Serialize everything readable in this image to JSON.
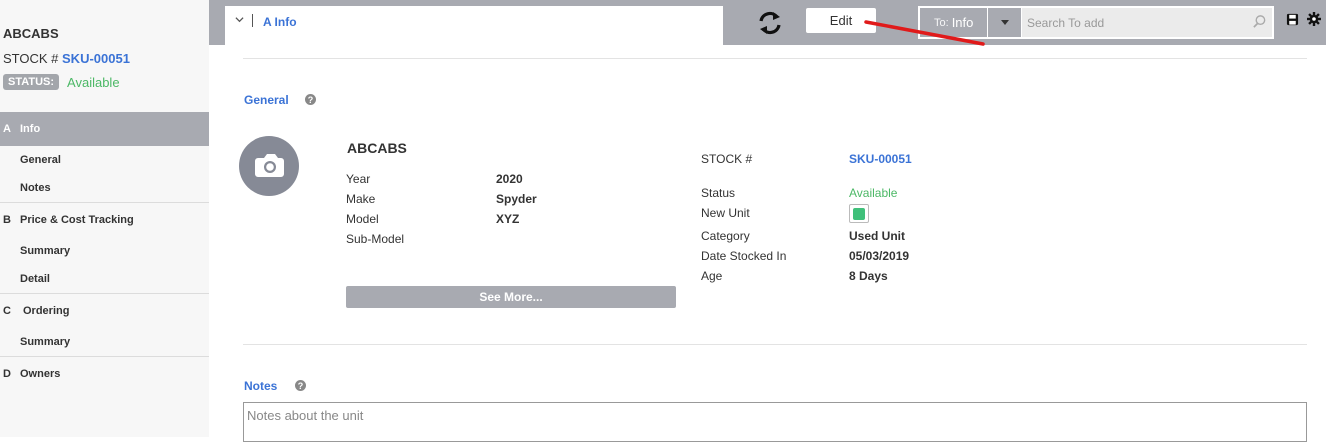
{
  "sidebar": {
    "unit_name": "ABCABS",
    "stock_prefix": "STOCK # ",
    "stock_number": "SKU-00051",
    "status_badge": "STATUS:",
    "status_value": "Available",
    "sections": [
      {
        "letter": "A",
        "label": "Info",
        "active": true,
        "items": [
          {
            "label": "General"
          },
          {
            "label": "Notes"
          }
        ]
      },
      {
        "letter": "B",
        "label": "Price & Cost Tracking",
        "items": [
          {
            "label": "Summary"
          },
          {
            "label": "Detail"
          }
        ]
      },
      {
        "letter": "C",
        "label": "Ordering",
        "items": [
          {
            "label": "Summary"
          }
        ]
      },
      {
        "letter": "D",
        "label": "Owners",
        "items": []
      }
    ]
  },
  "header": {
    "tab_label": "A Info",
    "edit_label": "Edit",
    "to_prefix": "To:",
    "to_value": "Info",
    "search_placeholder": "Search To add"
  },
  "general": {
    "title": "General",
    "unit_title": "ABCABS",
    "left_fields": [
      {
        "label": "Year",
        "value": "2020"
      },
      {
        "label": "Make",
        "value": "Spyder"
      },
      {
        "label": "Model",
        "value": "XYZ"
      },
      {
        "label": "Sub-Model",
        "value": ""
      }
    ],
    "stock_label": "STOCK #",
    "stock_value": "SKU-00051",
    "status_label": "Status",
    "status_value": "Available",
    "new_unit_label": "New Unit",
    "new_unit_checked": true,
    "category_label": "Category",
    "category_value": "Used Unit",
    "date_label": "Date Stocked In",
    "date_value": "05/03/2019",
    "age_label": "Age",
    "age_value": "8 Days",
    "see_more_label": "See More..."
  },
  "notes": {
    "title": "Notes",
    "placeholder": "Notes about the unit"
  },
  "colors": {
    "accent": "#3b73d6",
    "status_green": "#4cb866",
    "bar_gray": "#a8aab1",
    "checkbox_green": "#3fc07a"
  },
  "icons": {
    "refresh": "refresh-icon",
    "search": "search-icon",
    "save": "save-icon",
    "gear": "gear-icon",
    "camera": "camera-icon",
    "help": "help-icon",
    "chevron": "chevron-down-icon"
  }
}
